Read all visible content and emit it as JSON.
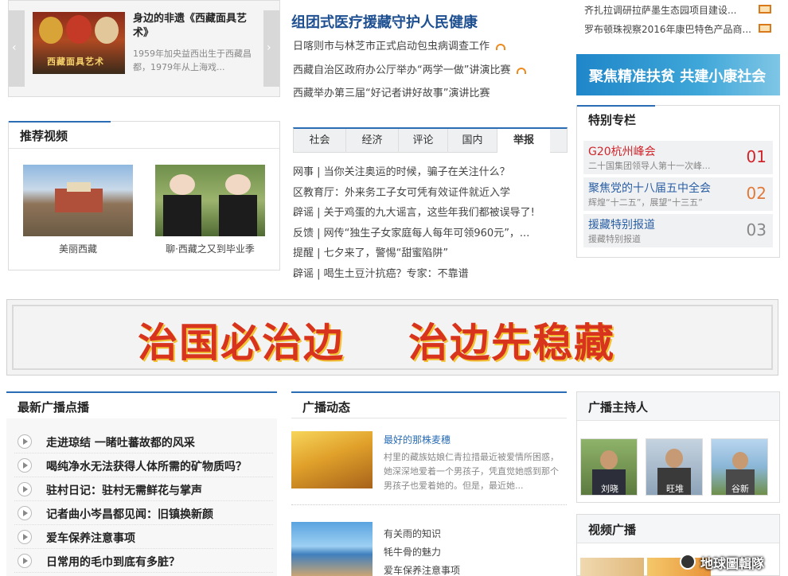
{
  "feature": {
    "title": "身边的非遗《西藏面具艺术》",
    "desc": "1959年加央益西出生于西藏昌都，1979年从上海戏...",
    "img_caption": "西藏面具艺术"
  },
  "headlines": {
    "main": "组团式医疗援藏守护人民健康",
    "items": [
      {
        "text": "日喀则市与林芝市正式启动包虫病调查工作",
        "audio": true
      },
      {
        "text": "西藏自治区政府办公厅举办“两学一做”讲演比赛",
        "audio": true
      },
      {
        "text": "西藏举办第三届“好记者讲好故事”演讲比赛",
        "audio": false
      }
    ]
  },
  "top_right": {
    "items": [
      "齐扎拉调研拉萨墨生态园项目建设...",
      "罗布顿珠视察2016年康巴特色产品商..."
    ],
    "banner": "聚焦精准扶贫 共建小康社会"
  },
  "recommended_video": {
    "title": "推荐视频",
    "items": [
      {
        "caption": "美丽西藏"
      },
      {
        "caption": "聊·西藏之又到毕业季"
      }
    ]
  },
  "tabs": {
    "labels": [
      "社会",
      "经济",
      "评论",
      "国内",
      "举报"
    ],
    "active_index": 4,
    "list": [
      "网事 | 当你关注奥运的时候，骗子在关注什么？",
      "区教育厅：外来务工子女可凭有效证件就近入学",
      "辟谣 | 关于鸡蛋的九大谣言，这些年我们都被误导了!",
      "反馈 | 网传“独生子女家庭每人每年可领960元”，...",
      "提醒 | 七夕来了，警惕“甜蜜陷阱”",
      "辟谣 | 喝生土豆汁抗癌？专家：不靠谱"
    ]
  },
  "special": {
    "title": "特别专栏",
    "items": [
      {
        "heading": "G20杭州峰会",
        "sub": "二十国集团领导人第十一次峰...",
        "num": "01",
        "heading_color": "#d0252b",
        "num_color": "#d0252b"
      },
      {
        "heading": "聚焦党的十八届五中全会",
        "sub": "辉煌“十二五”，展望“十三五”",
        "num": "02",
        "heading_color": "#2a5fa4",
        "num_color": "#e07a3a"
      },
      {
        "heading": "援藏特别报道",
        "sub": "援藏特别报道",
        "num": "03",
        "heading_color": "#2a5fa4",
        "num_color": "#888888"
      }
    ]
  },
  "big_banner": {
    "left": "治国必治边",
    "right": "治边先稳藏"
  },
  "broadcast_list": {
    "title": "最新广播点播",
    "items": [
      "走进琼结 一睹吐蕃故都的风采",
      "喝纯净水无法获得人体所需的矿物质吗？",
      "驻村日记：驻村无需鲜花与掌声",
      "记者曲小岑昌都见闻：旧镇换新颜",
      "爱车保养注意事项",
      "日常用的毛巾到底有多脏？"
    ]
  },
  "broadcast_news": {
    "title": "广播动态",
    "feature_title": "最好的那株麦穗",
    "feature_desc": "村里的藏族姑娘仁青拉措最近被爱情所困惑，她深深地爱着一个男孩子，凭直觉她感到那个男孩子也爱着她的。但是，最近她...",
    "more": [
      "有关雨的知识",
      "牦牛骨的魅力",
      "爱车保养注意事项"
    ]
  },
  "hosts": {
    "title": "广播主持人",
    "items": [
      {
        "name": "刘晓"
      },
      {
        "name": "旺堆"
      },
      {
        "name": "谷新"
      }
    ]
  },
  "video_broadcast": {
    "title": "视频广播"
  },
  "watermark": "地球圖輯隊",
  "colors": {
    "accent_blue": "#2a6db5",
    "banner_red": "#d8331d",
    "headline_blue": "#1d4f91"
  }
}
